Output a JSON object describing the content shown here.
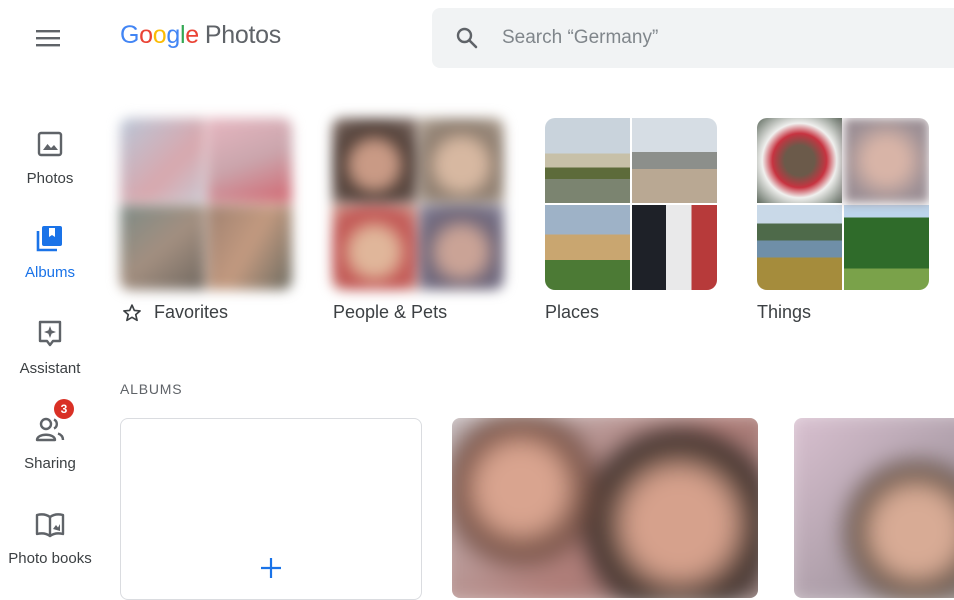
{
  "header": {
    "menu_icon": "hamburger-menu-icon",
    "logo": {
      "letters": [
        "G",
        "o",
        "o",
        "g",
        "l",
        "e"
      ],
      "letter_colors": [
        "#4285F4",
        "#EA4335",
        "#FBBC05",
        "#4285F4",
        "#34A853",
        "#EA4335"
      ],
      "product": "Photos"
    },
    "search": {
      "placeholder": "Search “Germany”",
      "icon": "search-icon"
    }
  },
  "sidebar": {
    "items": [
      {
        "label": "Photos",
        "icon": "photo-icon",
        "active": false
      },
      {
        "label": "Albums",
        "icon": "albums-icon",
        "active": true
      },
      {
        "label": "Assistant",
        "icon": "assistant-icon",
        "active": false
      },
      {
        "label": "Sharing",
        "icon": "sharing-icon",
        "active": false,
        "badge": "3"
      },
      {
        "label": "Photo books",
        "icon": "photo-books-icon",
        "active": false
      }
    ]
  },
  "categories": [
    {
      "label": "Favorites",
      "icon": "star-outline-icon",
      "blurred": true
    },
    {
      "label": "People & Pets",
      "blurred": true
    },
    {
      "label": "Places",
      "blurred": false
    },
    {
      "label": "Things",
      "blurred": false
    }
  ],
  "albums": {
    "section_title": "ALBUMS",
    "new_album_icon": "plus-icon"
  },
  "colors": {
    "accent": "#1a73e8",
    "badge": "#d93025",
    "search_bg": "#f1f3f4"
  }
}
